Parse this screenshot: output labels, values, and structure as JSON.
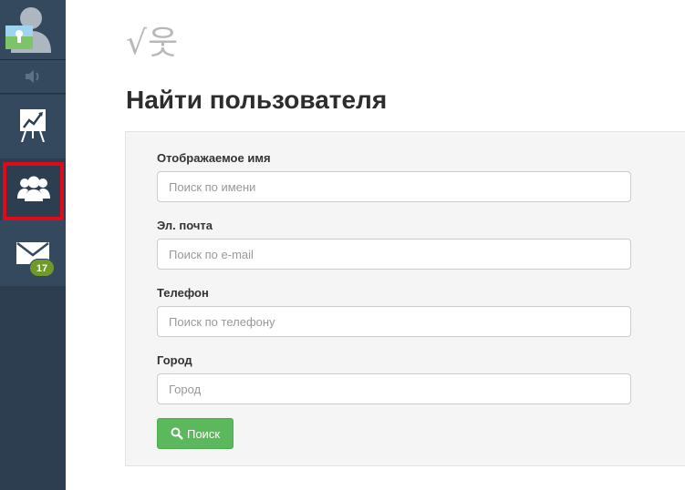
{
  "sidebar": {
    "mail_badge": "17"
  },
  "header": {
    "logo": "√웃",
    "title": "Найти пользователя"
  },
  "form": {
    "display_name": {
      "label": "Отображаемое имя",
      "placeholder": "Поиск по имени",
      "value": ""
    },
    "email": {
      "label": "Эл. почта",
      "placeholder": "Поиск по e-mail",
      "value": ""
    },
    "phone": {
      "label": "Телефон",
      "placeholder": "Поиск по телефону",
      "value": ""
    },
    "city": {
      "label": "Город",
      "placeholder": "Город",
      "value": ""
    },
    "search_button": "Поиск"
  },
  "colors": {
    "sidebar": "#2c3e50",
    "highlight": "#e00b1a",
    "button": "#5cb85c",
    "badge": "#6f9a2a"
  }
}
